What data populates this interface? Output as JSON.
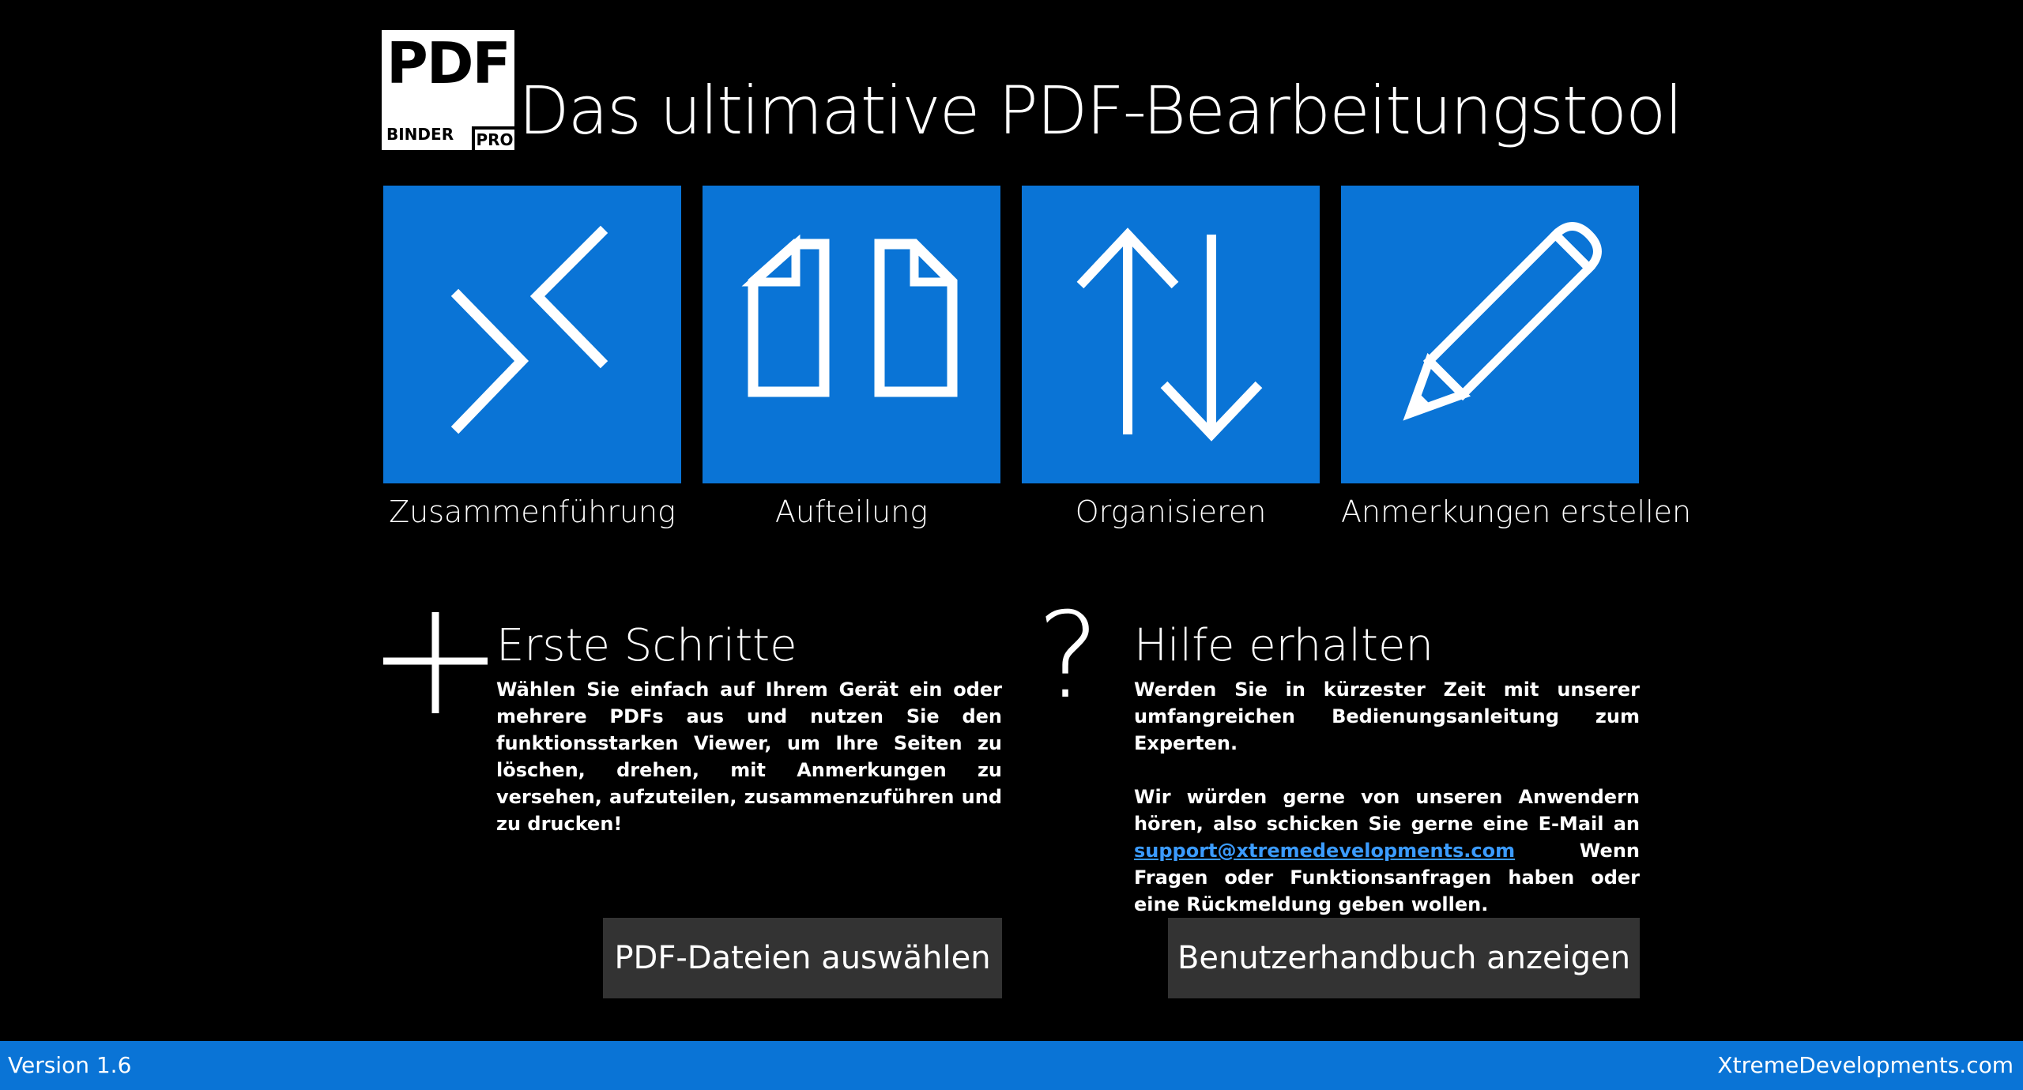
{
  "header": {
    "logo": {
      "pdf": "PDF",
      "binder": "BINDER",
      "pro": "PRO"
    },
    "title": "Das ultimative PDF-Bearbeitungstool"
  },
  "tiles": [
    {
      "label": "Zusammenführung",
      "icon": "merge-icon"
    },
    {
      "label": "Aufteilung",
      "icon": "split-icon"
    },
    {
      "label": "Organisieren",
      "icon": "organize-arrows-icon"
    },
    {
      "label": "Anmerkungen erstellen",
      "icon": "pencil-icon"
    }
  ],
  "getting_started": {
    "icon": "plus-icon",
    "title": "Erste Schritte",
    "text": "Wählen Sie einfach auf Ihrem Gerät ein oder mehrere PDFs aus und nutzen Sie den funktionsstarken Viewer, um Ihre Seiten zu löschen, drehen, mit Anmerkungen zu versehen, aufzuteilen, zusammenzuführen und zu drucken!",
    "button": "PDF-Dateien auswählen"
  },
  "help": {
    "icon": "question-mark-icon",
    "title": "Hilfe erhalten",
    "text1": "Werden Sie in kürzester Zeit mit unserer umfangreichen Bedienungsanleitung zum Experten.",
    "text2_before": "Wir würden gerne von unseren Anwendern hören, also schicken Sie gerne eine E-Mail an ",
    "email": "support@xtremedevelopments.com",
    "text2_after": " Wenn Fragen oder Funktionsanfragen haben oder eine Rückmeldung geben wollen.",
    "button": "Benutzerhandbuch anzeigen"
  },
  "statusbar": {
    "version": "Version 1.6",
    "company": "XtremeDevelopments.com"
  },
  "colors": {
    "background": "#000000",
    "accent": "#0a74d6",
    "button": "#333333",
    "link": "#3b9bff"
  }
}
